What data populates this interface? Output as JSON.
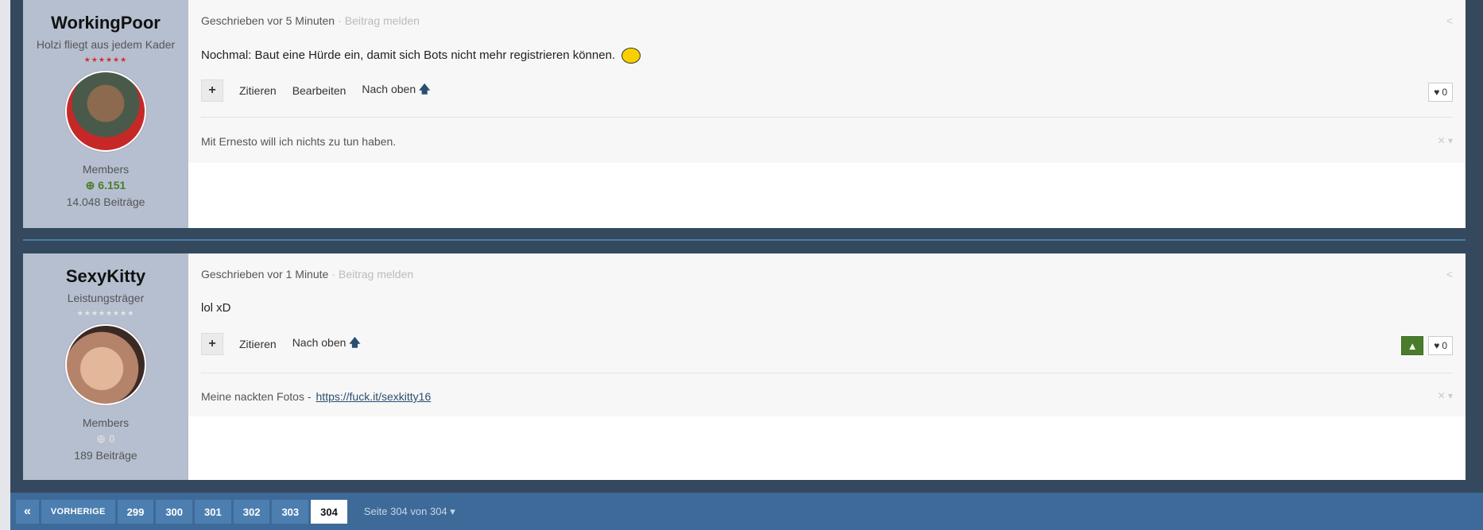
{
  "posts": [
    {
      "username": "WorkingPoor",
      "rank": "Holzi fliegt aus jedem Kader",
      "pips": "★★★★★★",
      "group": "Members",
      "reputation": "⊕ 6.151",
      "post_count": "14.048 Beiträge",
      "meta_prefix": "Geschrieben vor 5 Minuten",
      "report_label": "Beitrag melden",
      "text": "Nochmal: Baut eine Hürde ein, damit sich Bots nicht mehr registrieren können.",
      "actions": {
        "quote": "Zitieren",
        "edit": "Bearbeiten",
        "top": "Nach oben"
      },
      "likes": "0",
      "signature": "Mit Ernesto will ich nichts zu tun haben."
    },
    {
      "username": "SexyKitty",
      "rank": "Leistungsträger",
      "pips": "★★★★★★★★",
      "group": "Members",
      "reputation": "⊕ 0",
      "post_count": "189 Beiträge",
      "meta_prefix": "Geschrieben vor 1 Minute",
      "report_label": "Beitrag melden",
      "text": "lol xD",
      "actions": {
        "quote": "Zitieren",
        "top": "Nach oben"
      },
      "likes": "0",
      "signature": "Meine nackten Fotos -",
      "signature_link": "https://fuck.it/sexkitty16"
    }
  ],
  "pagination": {
    "first_icon": "«",
    "prev_label": "VORHERIGE",
    "pages": [
      "299",
      "300",
      "301",
      "302",
      "303",
      "304"
    ],
    "active_page": "304",
    "info": "Seite 304 von 304 ▾"
  },
  "colors": {
    "frame": "#34495e",
    "sidebar": "#b6bfd0",
    "pagebar": "#3d6a99",
    "upvote": "#4a7d2b"
  }
}
